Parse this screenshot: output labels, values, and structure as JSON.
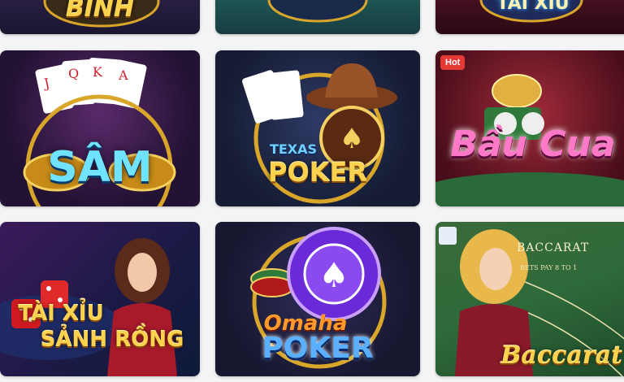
{
  "games": [
    {
      "title": "BINH"
    },
    {
      "title": ""
    },
    {
      "title": "TÀI XỈU"
    },
    {
      "title": "SÂM"
    },
    {
      "title_top": "TEXAS",
      "title_bottom": "POKER"
    },
    {
      "title": "Bầu Cua",
      "badge": "Hot"
    },
    {
      "title_top": "TÀI XỈU",
      "title_bottom": "SẢNH RỒNG"
    },
    {
      "title_top": "Omaha",
      "title_bottom": "POKER"
    },
    {
      "title": "Baccarat",
      "table_text": "BACCARAT",
      "table_sub": "BETS PAY 8 TO 1"
    }
  ],
  "colors": {
    "accent_gold": "#fbd24e",
    "hot_red": "#e53935",
    "felt_green": "#2f6a3a"
  }
}
